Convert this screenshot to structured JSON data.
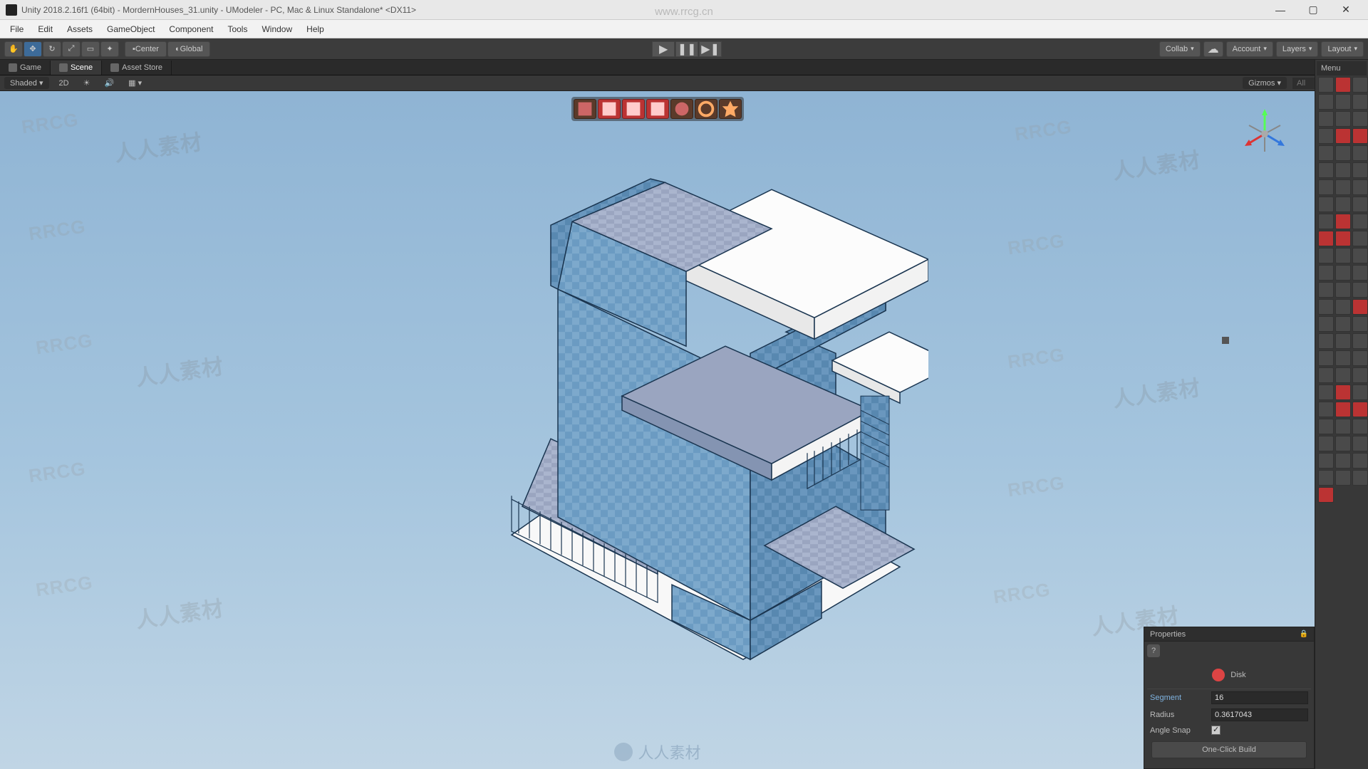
{
  "titlebar": {
    "text": "Unity 2018.2.16f1 (64bit) - MordernHouses_31.unity - UModeler - PC, Mac & Linux Standalone* <DX11>"
  },
  "menubar": {
    "items": [
      "File",
      "Edit",
      "Assets",
      "GameObject",
      "Component",
      "Tools",
      "Window",
      "Help"
    ]
  },
  "toolbar": {
    "center": "Center",
    "global": "Global",
    "collab": "Collab",
    "account": "Account",
    "layers": "Layers",
    "layout": "Layout"
  },
  "tabs": {
    "game": "Game",
    "scene": "Scene",
    "asset_store": "Asset Store"
  },
  "scene_controls": {
    "shaded": "Shaded",
    "mode_2d": "2D",
    "gizmos": "Gizmos",
    "search_placeholder": "All"
  },
  "tool_panel": {
    "header": "Menu"
  },
  "properties": {
    "title": "Properties",
    "tool_name": "Disk",
    "segment_label": "Segment",
    "segment_value": "16",
    "radius_label": "Radius",
    "radius_value": "0.3617043",
    "angle_snap_label": "Angle Snap",
    "build_button": "One-Click Build"
  },
  "watermarks": {
    "url": "www.rrcg.cn",
    "rrcg": "RRCG",
    "cn": "人人素材"
  }
}
